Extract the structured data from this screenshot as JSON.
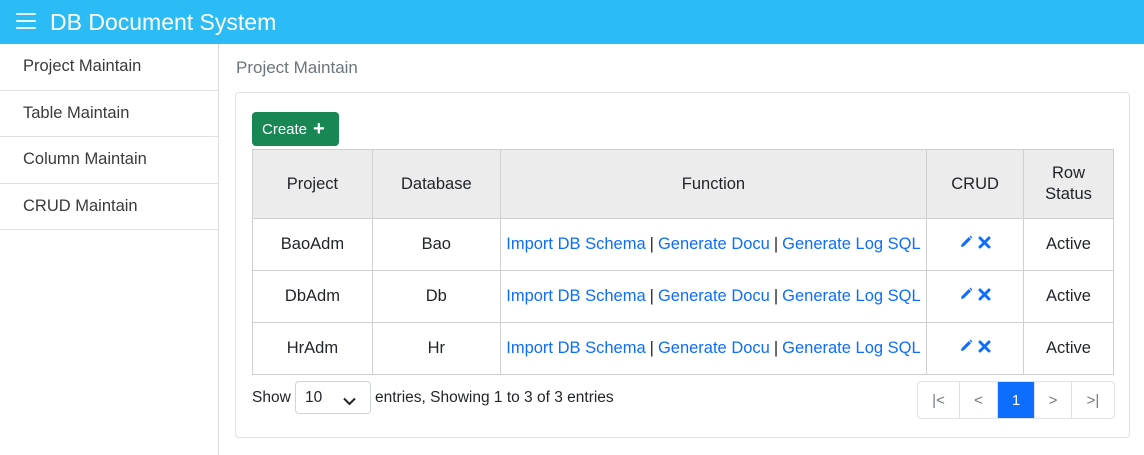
{
  "app": {
    "title": "DB Document System"
  },
  "sidebar": {
    "items": [
      {
        "label": "Project Maintain"
      },
      {
        "label": "Table Maintain"
      },
      {
        "label": "Column Maintain"
      },
      {
        "label": "CRUD Maintain"
      }
    ]
  },
  "main": {
    "title": "Project Maintain",
    "create_label": "Create",
    "table": {
      "headers": [
        "Project",
        "Database",
        "Function",
        "CRUD",
        "Row Status"
      ],
      "function_links": [
        "Import DB Schema",
        "Generate Docu",
        "Generate Log SQL"
      ],
      "rows": [
        {
          "project": "BaoAdm",
          "database": "Bao",
          "status": "Active"
        },
        {
          "project": "DbAdm",
          "database": "Db",
          "status": "Active"
        },
        {
          "project": "HrAdm",
          "database": "Hr",
          "status": "Active"
        }
      ]
    },
    "footer": {
      "show_label": "Show",
      "page_size": "10",
      "entries_text": "entries, Showing 1 to 3 of 3 entries"
    },
    "pagination": {
      "first": "|<",
      "prev": "<",
      "current": "1",
      "next": ">",
      "last": ">|"
    }
  },
  "colors": {
    "header_bg": "#2bbcf6",
    "create_bg": "#198754",
    "link": "#0d6efd",
    "active_page": "#0d6efd"
  },
  "icons": [
    "menu-icon",
    "plus-icon",
    "pencil-icon",
    "delete-icon",
    "chevron-down-icon"
  ]
}
